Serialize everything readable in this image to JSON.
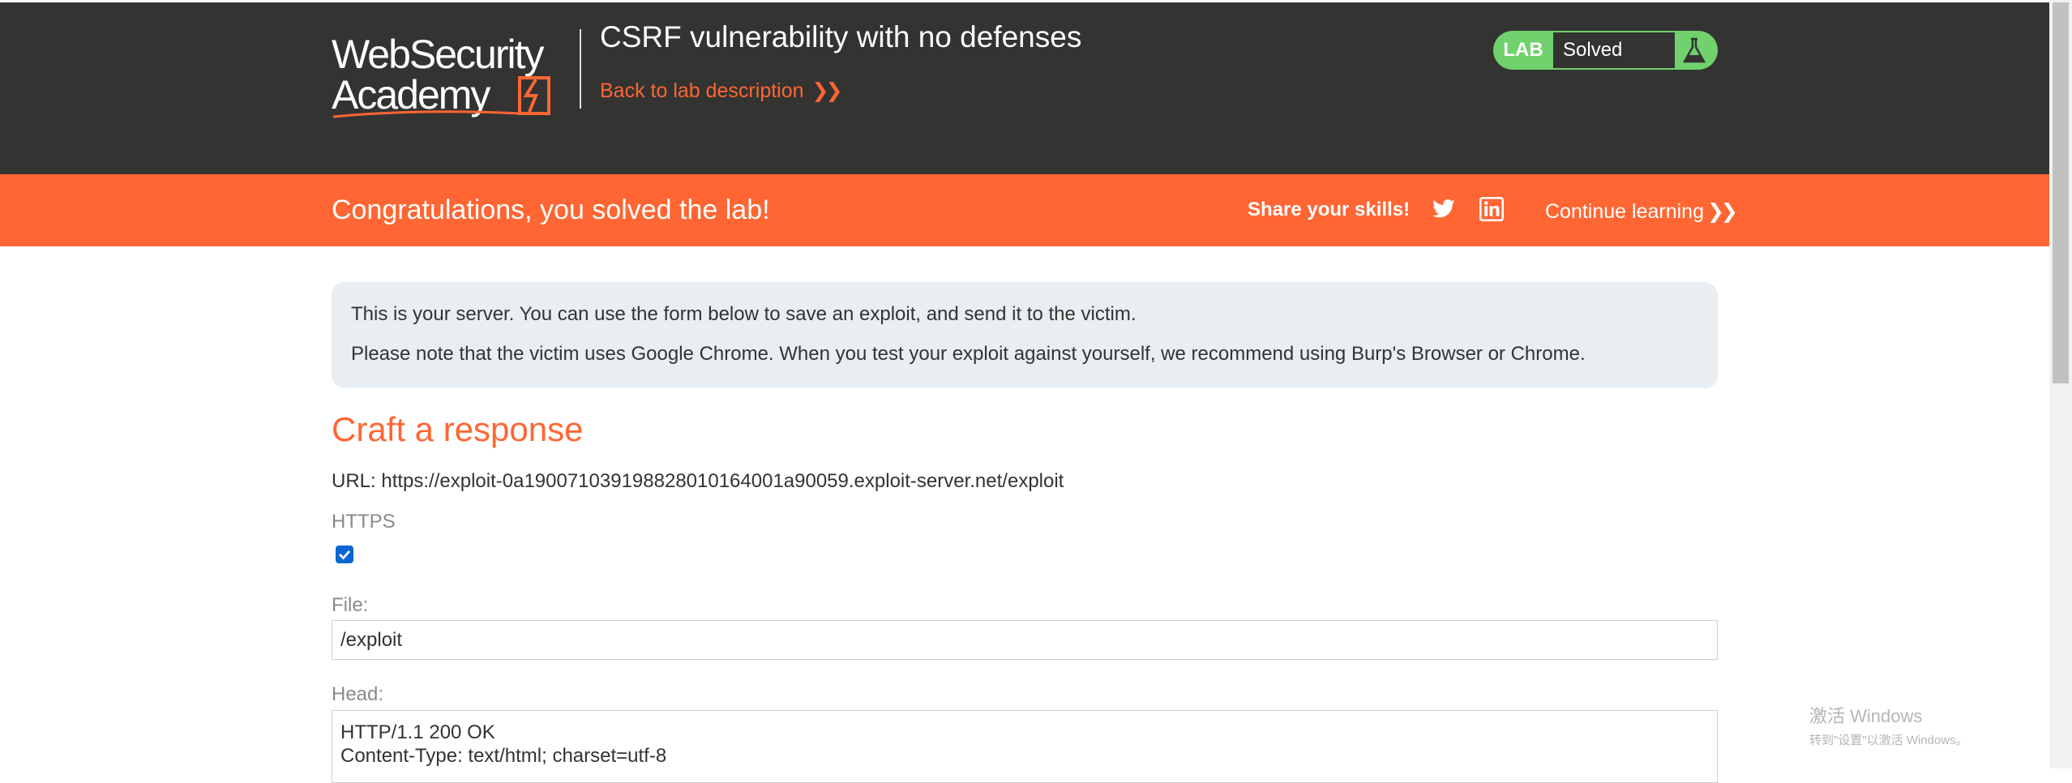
{
  "header": {
    "logo_line1": "WebSecurity",
    "logo_line2": "Academy",
    "lab_title": "CSRF vulnerability with no defenses",
    "back_link": "Back to lab description",
    "status": {
      "lab_label": "LAB",
      "status_text": "Solved",
      "icon": "flask-icon"
    }
  },
  "banner": {
    "message": "Congratulations, you solved the lab!",
    "share_label": "Share your skills!",
    "twitter_icon": "twitter-icon",
    "linkedin_icon": "linkedin-icon",
    "continue_link": "Continue learning"
  },
  "info": {
    "line1": "This is your server. You can use the form below to save an exploit, and send it to the victim.",
    "line2": "Please note that the victim uses Google Chrome. When you test your exploit against yourself, we recommend using Burp's Browser or Chrome."
  },
  "form": {
    "section_title": "Craft a response",
    "url": "URL: https://exploit-0a19007103919882801016400 1a90059.exploit-server.net/exploit",
    "https_label": "HTTPS",
    "https_checked": true,
    "file_label": "File:",
    "file_value": "/exploit",
    "head_label": "Head:",
    "head_lines": [
      "HTTP/1.1 200 OK",
      "Content-Type: text/html; charset=utf-8"
    ]
  },
  "watermark": {
    "line1": "激活 Windows",
    "line2": "转到\"设置\"以激活 Windows。"
  },
  "colors": {
    "header_bg": "#333332",
    "accent": "#ff6633",
    "solved_green": "#70d16d",
    "info_bg": "#e8eef1",
    "checkbox_blue": "#0b66d4"
  }
}
